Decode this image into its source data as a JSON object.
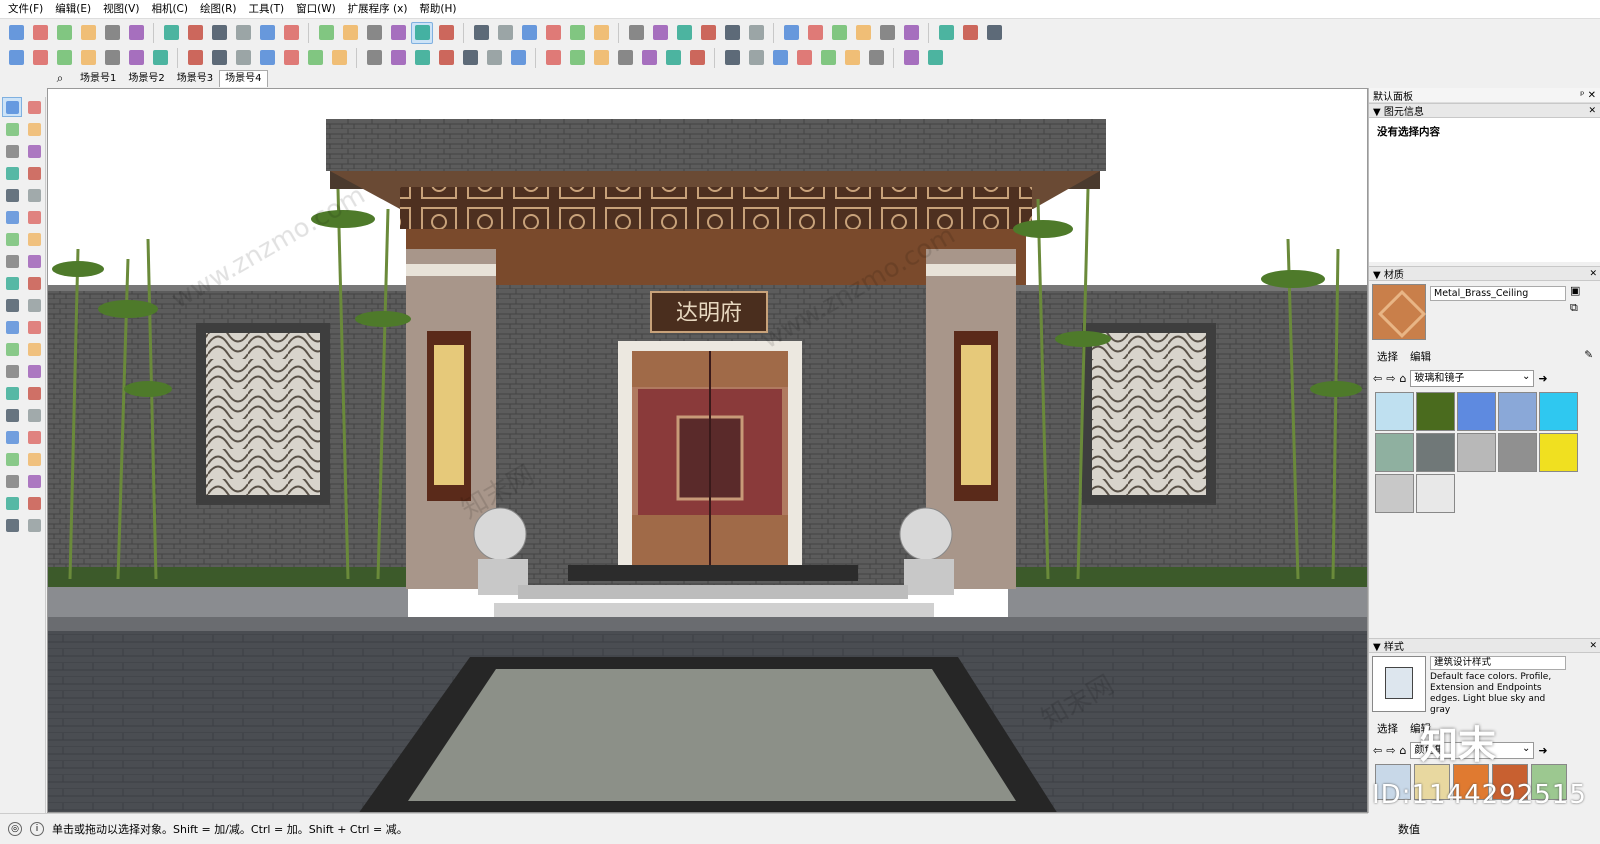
{
  "menu": [
    "文件(F)",
    "编辑(E)",
    "视图(V)",
    "相机(C)",
    "绘图(R)",
    "工具(T)",
    "窗口(W)",
    "扩展程序 (x)",
    "帮助(H)"
  ],
  "toolbar_row1": [
    "new-icon",
    "open-icon",
    "save-icon",
    "cut-icon",
    "copy-icon",
    "paste-icon",
    "erase-icon",
    "undo-icon",
    "redo-icon",
    "print-icon",
    "model-info-icon",
    "xray-icon",
    "back-edges-icon",
    "wireframe-icon",
    "hidden-line-icon",
    "shaded-icon",
    "shaded-texture-icon",
    "monochrome-icon",
    "iso-icon",
    "top-icon",
    "front-icon",
    "right-icon",
    "back-icon",
    "left-icon",
    "component-icon",
    "group-icon",
    "section-icon",
    "section-display-icon",
    "section-cut-icon",
    "shadow-icon",
    "fog-icon",
    "edge-style-icon",
    "profile-icon",
    "3dwarehouse-icon",
    "extension-icon",
    "layout-icon",
    "plugin-icon",
    "style-icon",
    "material-icon"
  ],
  "toolbar_row2": [
    "text-icon",
    "dim-icon",
    "section-plane-icon",
    "follow-me-icon",
    "offset-icon",
    "push-pull-icon",
    "intersect-icon",
    "outer-shell-icon",
    "union-icon",
    "subtract-icon",
    "trim-icon",
    "split-icon",
    "sandbox-icon",
    "smoove-icon",
    "stamp-icon",
    "drape-icon",
    "flip-icon",
    "add-detail-icon",
    "photo-match-icon",
    "solid-icon",
    "camera-icon",
    "walk-icon",
    "look-icon",
    "position-camera-icon",
    "tape-icon",
    "protractor-icon",
    "axes-icon",
    "3dtext-icon",
    "paint-icon",
    "shadow-settings-icon",
    "skin-icon",
    "xy-icon",
    "render-icon",
    "play-icon",
    "stop-icon",
    "settings-icon",
    "help-icon"
  ],
  "scenes": [
    "场景号1",
    "场景号2",
    "场景号3",
    "场景号4"
  ],
  "active_scene": "场景号4",
  "viewport": {
    "plaque_text": "达明府",
    "watermarks": [
      "www.znzmo.com",
      "知末网",
      "www.znzmo.com",
      "知末网"
    ]
  },
  "panel": {
    "title": "默认面板",
    "entity_info": {
      "heading": "图元信息",
      "body": "没有选择内容"
    },
    "materials": {
      "heading": "材质",
      "current_name": "Metal_Brass_Ceiling",
      "tabs": [
        "选择",
        "编辑"
      ],
      "library": "玻璃和镜子",
      "swatches": [
        "#bfe0f0",
        "#4a6b1e",
        "#5e8ae0",
        "#8aa8d8",
        "#2fc8f0",
        "#8fb0a0",
        "#707878",
        "#b8b8b8",
        "#909090",
        "#f0e020",
        "#c8c8c8",
        "#e8e8e8"
      ]
    },
    "styles": {
      "heading": "样式",
      "current_name": "建筑设计样式",
      "description": "Default face colors. Profile, Extension and Endpoints edges. Light blue sky and gray",
      "tabs": [
        "选择",
        "编辑"
      ],
      "library": "颜色集",
      "thumbs": [
        "#c8d8e8",
        "#e8d8a0",
        "#e07a30",
        "#c86030",
        "#9cc890"
      ]
    },
    "value_label": "数值"
  },
  "status": {
    "text": "单击或拖动以选择对象。Shift = 加/减。Ctrl = 加。Shift + Ctrl = 减。"
  },
  "watermark_id": "ID:1144292515",
  "watermark_logo": "知末"
}
